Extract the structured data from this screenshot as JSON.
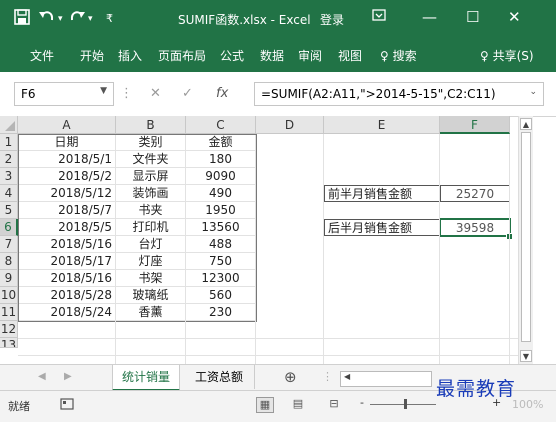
{
  "titlebar": {
    "save_icon": "save-icon",
    "undo_icon": "undo-icon",
    "redo_icon": "redo-icon",
    "customize_icon": "customize-icon",
    "title": "SUMIF函数.xlsx - Excel",
    "login": "登录",
    "ribbon_display_icon": "ribbon-display-icon",
    "minimize": "—",
    "maximize": "☐",
    "close": "✕"
  },
  "ribbon": {
    "tabs": [
      "文件",
      "开始",
      "插入",
      "页面布局",
      "公式",
      "数据",
      "审阅",
      "视图"
    ],
    "tell_me": "♀ 搜索",
    "share": "♀ 共享(S)"
  },
  "formula_bar": {
    "name_box": "F6",
    "name_box_arrow": "▼",
    "sep": "⋮",
    "cancel": "✕",
    "enter": "✓",
    "fx": "fx",
    "formula": "=SUMIF(A2:A11,\">2014-5-15\",C2:C11)",
    "expand": "⌄"
  },
  "grid": {
    "columns": [
      "A",
      "B",
      "C",
      "D",
      "E",
      "F"
    ],
    "rows": [
      "1",
      "2",
      "3",
      "4",
      "5",
      "6",
      "7",
      "8",
      "9",
      "10",
      "11",
      "12",
      "13"
    ],
    "headers": [
      "日期",
      "类别",
      "金额"
    ],
    "data": [
      [
        "2018/5/1",
        "文件夹",
        "180"
      ],
      [
        "2018/5/2",
        "显示屏",
        "9090"
      ],
      [
        "2018/5/12",
        "装饰画",
        "490"
      ],
      [
        "2018/5/7",
        "书夹",
        "1950"
      ],
      [
        "2018/5/5",
        "打印机",
        "13560"
      ],
      [
        "2018/5/16",
        "台灯",
        "488"
      ],
      [
        "2018/5/17",
        "灯座",
        "750"
      ],
      [
        "2018/5/16",
        "书架",
        "12300"
      ],
      [
        "2018/5/28",
        "玻璃纸",
        "560"
      ],
      [
        "2018/5/24",
        "香薰",
        "230"
      ]
    ],
    "summary": [
      {
        "label": "前半月销售金额",
        "value": "25270"
      },
      {
        "label": "后半月销售金额",
        "value": "39598"
      }
    ]
  },
  "sheets": {
    "nav_prev": "◀",
    "nav_next": "▶",
    "tabs": [
      "统计销量",
      "工资总额"
    ],
    "add": "⊕",
    "sep": "⋮",
    "scroll_left": "◀"
  },
  "status": {
    "ready": "就绪",
    "macro_icon": "macro-record-icon",
    "views": [
      "▦",
      "▤",
      "⊟"
    ],
    "zoom_minus": "-",
    "zoom_plus": "+",
    "zoom": "100%"
  },
  "watermark": "最需教育",
  "colors": {
    "excel_green": "#217346",
    "watermark": "#1a3cb8"
  }
}
